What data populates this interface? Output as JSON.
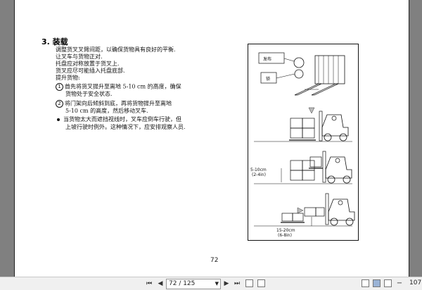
{
  "document": {
    "section_title": "3. 装载",
    "lines": [
      "调整货叉叉臂间距，以确保货物具有良好的平衡.",
      "让叉车与货物正对.",
      "托盘应对称放置于货叉上.",
      "货叉应尽可能插入托盘底部.",
      "提升货物:"
    ],
    "step1": {
      "num": "1",
      "line1": "首先将货叉提升至离地 5-10 cm 的高度，确保",
      "line2": "货物处于安全状态."
    },
    "step2": {
      "num": "2",
      "line1": "将门架向后倾斜到底，再将货物提升至离地",
      "line2": "5-10 cm 的高度，然后移动叉车."
    },
    "bullet": {
      "line1": "当货物太大而遮挡视线时，叉车应倒车行驶，但",
      "line2": "上坡行驶时例外。这种情况下，应安排观察人员."
    },
    "figure": {
      "label_release": "发布",
      "label_lock": "锁",
      "dim1": "5-10cm",
      "dim1_in": "(2-4in)",
      "dim2": "15-20cm",
      "dim2_in": "(6-8in)"
    },
    "page_number": "72"
  },
  "toolbar": {
    "first_label": "⏮",
    "prev_label": "◀",
    "page_value": "72 / 125",
    "next_label": "▶",
    "last_label": "⏭",
    "zoom_value": "107"
  }
}
